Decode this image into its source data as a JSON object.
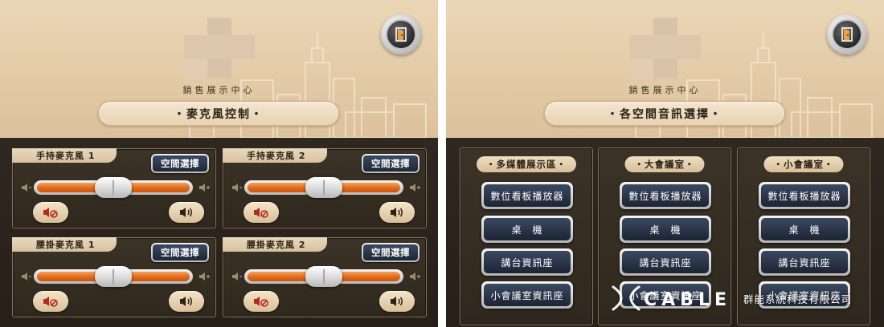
{
  "left_screen": {
    "subtitle": "銷售展示中心",
    "page_title": "・麥克風控制・",
    "exit_icon": "exit-door-icon",
    "mics": [
      {
        "label": "手持麥克風 1",
        "space_button": "空間選擇",
        "volume_level": 0.5
      },
      {
        "label": "手持麥克風 2",
        "space_button": "空間選擇",
        "volume_level": 0.5
      },
      {
        "label": "腰掛麥克風 1",
        "space_button": "空間選擇",
        "volume_level": 0.5
      },
      {
        "label": "腰掛麥克風 2",
        "space_button": "空間選擇",
        "volume_level": 0.5
      }
    ]
  },
  "right_screen": {
    "subtitle": "銷售展示中心",
    "page_title": "・各空間音訊選擇・",
    "exit_icon": "exit-door-icon",
    "zones": [
      {
        "label": "・多媒體展示區・",
        "sources": [
          "數位看板播放器",
          "桌　機",
          "講台資訊座",
          "小會議室資訊座"
        ]
      },
      {
        "label": "・大會議室・",
        "sources": [
          "數位看板播放器",
          "桌　機",
          "講台資訊座",
          "小會議室資訊座"
        ]
      },
      {
        "label": "・小會議室・",
        "sources": [
          "數位看板播放器",
          "桌　機",
          "講台資訊座",
          "小會議室資訊座"
        ]
      }
    ]
  },
  "watermark": {
    "brand": "CABLE",
    "company": "群能系統科技有限公司"
  },
  "colors": {
    "header_bg": "#e3cba7",
    "body_bg": "#2b251d",
    "slider_fill": "#e06a1b",
    "button_blue": "#2a3548",
    "label_beige": "#e5d2b2"
  }
}
